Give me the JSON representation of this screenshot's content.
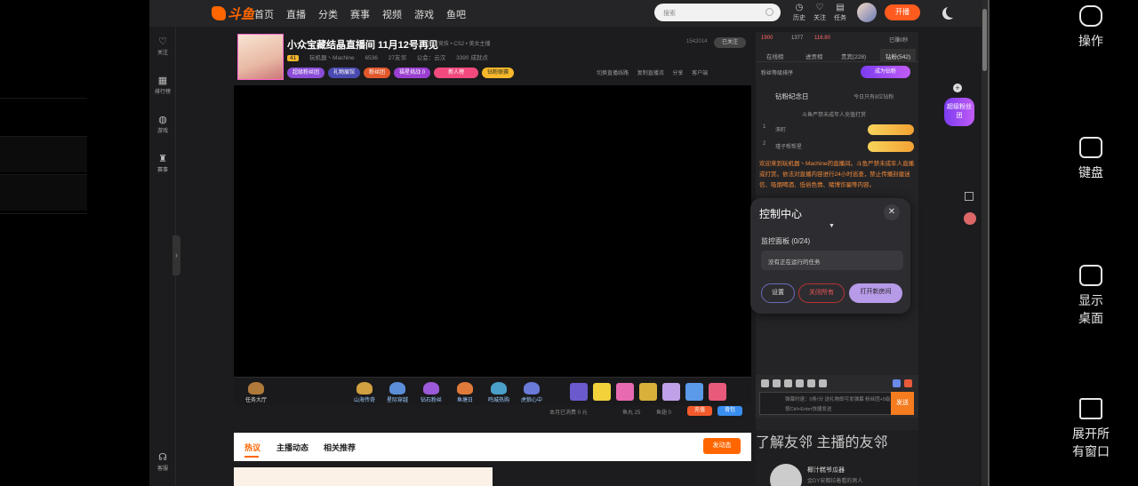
{
  "topbar": {
    "logo_text": "斗鱼",
    "nav": [
      "首页",
      "直播",
      "分类",
      "赛事",
      "视频",
      "游戏",
      "鱼吧"
    ],
    "search_placeholder": "搜索",
    "icons": [
      {
        "glyph": "◷",
        "label": "历史"
      },
      {
        "glyph": "♡",
        "label": "关注"
      },
      {
        "glyph": "▤",
        "label": "任务"
      }
    ],
    "live_btn": "开播"
  },
  "sidebar": [
    {
      "glyph": "♡",
      "label": "关注"
    },
    {
      "glyph": "▦",
      "label": "排行榜"
    },
    {
      "glyph": "◍",
      "label": "游戏"
    },
    {
      "glyph": "♜",
      "label": "赛事"
    },
    {
      "glyph": "☊",
      "label": "客服"
    }
  ],
  "room": {
    "title": "小众宝藏结晶直播间 11月12号再见",
    "category": "网游竞技 • CS2 • 美女主播",
    "room_id": "1542014",
    "follow": "已关注",
    "host": "玩机器丶Machine",
    "heat": "6536",
    "fans": "27友邻",
    "guild": "公会：云汉",
    "achieve": "3390 成就点",
    "level_badge": "41",
    "badges": [
      "超级粉丝团",
      "礼物展馆",
      "粉丝团",
      "福星挑战 0",
      "新人榜",
      "钻粉联赛"
    ],
    "actions": [
      "切换直播线路",
      "复制直播流",
      "分享",
      "客户端"
    ]
  },
  "gift_bar": {
    "task": "任务大厅",
    "items": [
      "山海传奇",
      "星际穿越",
      "钻石粉丝",
      "鱼塘日",
      "鸣城热购",
      "虎狼心中"
    ]
  },
  "below": {
    "consume": "本月已消费 0 元",
    "coins1": "鱼丸 25",
    "coins2": "鱼翅 0",
    "recharge": "充值",
    "pack": "背包"
  },
  "tabs": {
    "items": [
      "热议",
      "主播动态",
      "相关推荐"
    ],
    "post": "发动态"
  },
  "right_panel": {
    "counts": {
      "a": "1900",
      "b": "1377",
      "c": "116.80",
      "d": "已赚0秒"
    },
    "tabs": [
      "在线榜",
      "进贡榜",
      "贵宾(228)",
      "钻粉(542)"
    ],
    "sort": "粉丝等级排序",
    "join_btn": "成为钻粉",
    "anniv": "钻粉纪念日",
    "anniv_note": "今日只有8位钻粉",
    "warn": "斗鱼严禁未成年人充值打赏",
    "rows": [
      {
        "rank": "1",
        "name": "涿町"
      },
      {
        "rank": "2",
        "name": "瑾子帮帮星"
      }
    ],
    "notice": "欢迎来到玩机器丶Machine的直播间。斗鱼严禁未成年人直播或打赏。依法对直播内容进行24小时巡查，禁止传播封建迷信、吸烟喝酒、低俗色情、赌博诈骗等内容。",
    "chat_placeholder": "弹幕时速：0条/分 送礼物即可发弹幕 粉丝团+5级",
    "chat_hint": "按Ctrl+Enter快捷发送",
    "send": "发送",
    "bottom_tabs": [
      "了解友邻",
      "主播的友邻"
    ],
    "post_title": "椰汁糕爷瓜器",
    "post_sub": "金DY安都拉着看的男人"
  },
  "control": {
    "title": "控制中心",
    "monitor": "监控面板 (0/24)",
    "no_task": "没有正在运行的任务",
    "settings": "设置",
    "close_all": "关闭所有",
    "open_room": "打开新房间"
  },
  "float_badge": "超级粉丝团",
  "right_buttons": [
    "操作",
    "键盘",
    "显示\n桌面",
    "展开所\n有窗口"
  ]
}
